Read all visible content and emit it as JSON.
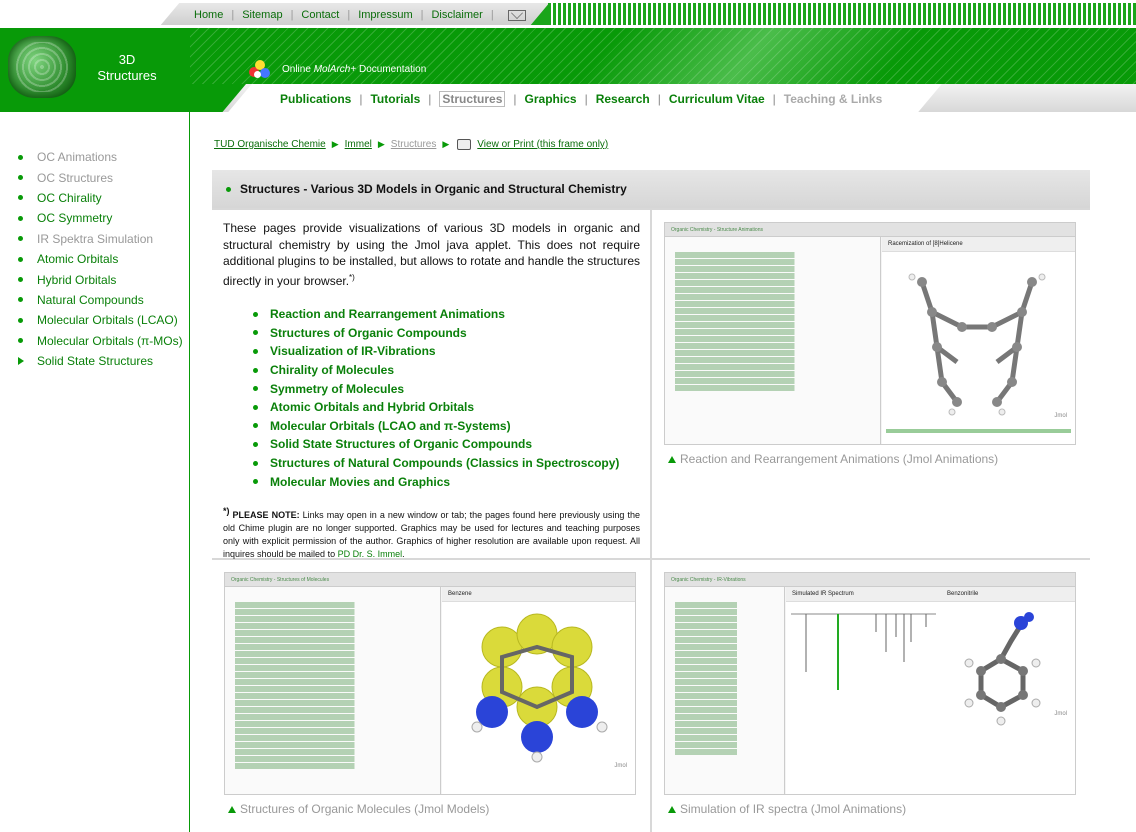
{
  "top_links": [
    "Home",
    "Sitemap",
    "Contact",
    "Impressum",
    "Disclaimer"
  ],
  "site": {
    "title_line1": "3D",
    "title_line2": "Structures",
    "subtitle_pre": "Online ",
    "subtitle_em": "MolArch",
    "subtitle_post": "+ Documentation"
  },
  "main_nav": [
    {
      "label": "Publications",
      "state": "normal"
    },
    {
      "label": "Tutorials",
      "state": "normal"
    },
    {
      "label": "Structures",
      "state": "current"
    },
    {
      "label": "Graphics",
      "state": "normal"
    },
    {
      "label": "Research",
      "state": "normal"
    },
    {
      "label": "Curriculum Vitae",
      "state": "normal"
    },
    {
      "label": "Teaching & Links",
      "state": "dim"
    }
  ],
  "sidebar": {
    "items": [
      {
        "label": "OC Animations",
        "color": "grey"
      },
      {
        "label": "OC Structures",
        "color": "grey"
      },
      {
        "label": "OC Chirality",
        "color": "green"
      },
      {
        "label": "OC Symmetry",
        "color": "green"
      },
      {
        "label": "IR Spektra Simulation",
        "color": "grey"
      },
      {
        "label": "Atomic Orbitals",
        "color": "green"
      },
      {
        "label": "Hybrid Orbitals",
        "color": "green"
      },
      {
        "label": "Natural Compounds",
        "color": "green"
      },
      {
        "label": "Molecular Orbitals (LCAO)",
        "color": "green"
      },
      {
        "label": "Molecular Orbitals (π-MOs)",
        "color": "green"
      },
      {
        "label": "Solid State Structures",
        "color": "green",
        "marker": "arrow"
      }
    ]
  },
  "breadcrumb": {
    "items": [
      "TUD Organische Chemie",
      "Immel",
      "Structures"
    ],
    "print_label": "View or Print (this frame only)"
  },
  "content": {
    "heading": "Structures - Various 3D Models in Organic and Structural Chemistry",
    "intro": "These pages provide visualizations of various 3D models in organic and structural chemistry by using the Jmol java applet. This does not require additional plugins to be installed, but allows to rotate and handle the structures directly in your browser.",
    "intro_sup": "*)",
    "links": [
      "Reaction and Rearrangement Animations",
      "Structures of Organic Compounds",
      "Visualization of IR-Vibrations",
      "Chirality of Molecules",
      "Symmetry of Molecules",
      "Atomic Orbitals and Hybrid Orbitals",
      "Molecular Orbitals (LCAO and π-Systems)",
      "Solid State Structures of Organic Compounds",
      "Structures of Natural Compounds (Classics in Spectroscopy)",
      "Molecular Movies and Graphics"
    ],
    "note_mark": "*)",
    "note_bold": "PLEASE NOTE:",
    "note_text": " Links may open in a new window or tab; the pages found here previously using the old Chime plugin are no longer supported. Graphics may be used for lectures and teaching purposes only with explicit permission of the author. Graphics of higher resolution are available upon request. All inquires should be mailed to ",
    "note_link": "PD Dr. S. Immel",
    "note_end": "."
  },
  "thumbnails": {
    "anim": {
      "caption": "Reaction and Rearrangement Animations (Jmol Animations)",
      "bar_title": "Organic Chemistry - Structure Animations",
      "viewer_title": "Racemization of [8]Helicene",
      "jmol": "Jmol"
    },
    "struct": {
      "caption": "Structures of Organic Molecules (Jmol Models)",
      "bar_title": "Organic Chemistry - Structures of Molecules",
      "viewer_title": "Benzene",
      "jmol": "Jmol"
    },
    "ir": {
      "caption": "Simulation of IR spectra (Jmol Animations)",
      "bar_title": "Organic Chemistry - IR-Vibrations",
      "viewer_title": "Simulated IR Spectrum",
      "viewer_title2": "Benzonitrile",
      "jmol": "Jmol"
    }
  },
  "colors": {
    "brand_green": "#089a08",
    "link_green": "#0a800a",
    "grey_text": "#999999"
  }
}
